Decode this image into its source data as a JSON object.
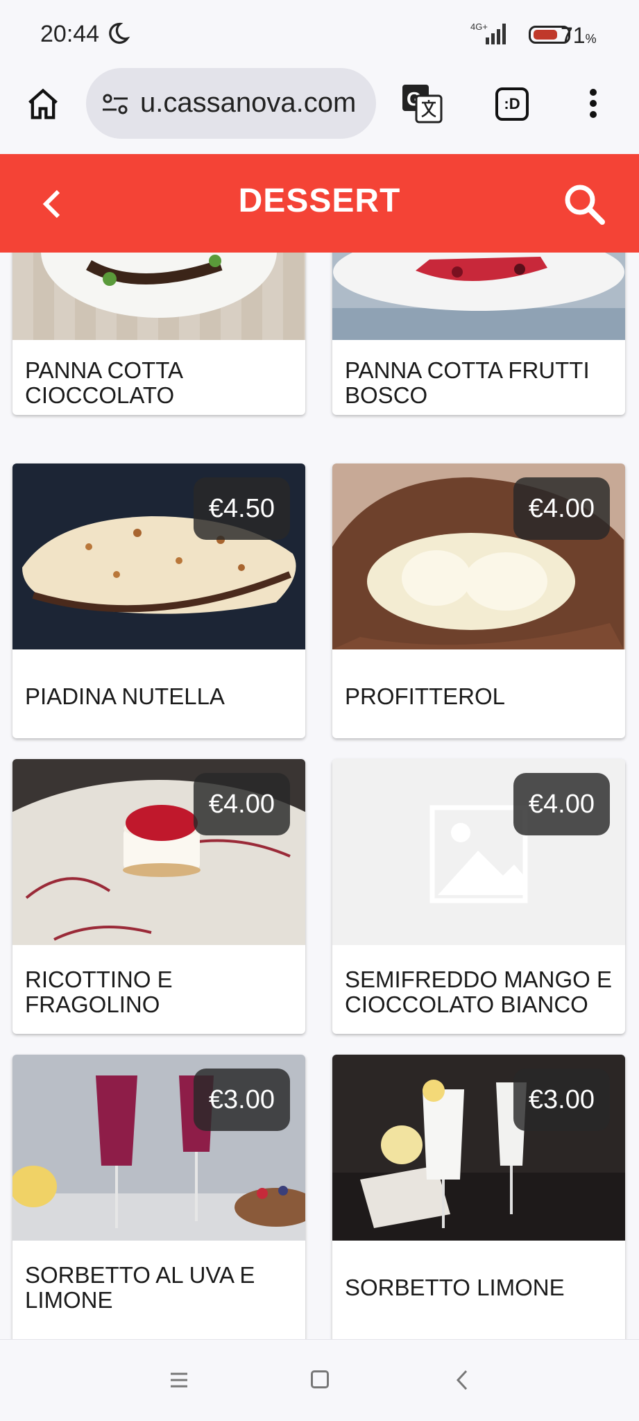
{
  "status_bar": {
    "time": "20:44",
    "network": "4G+",
    "battery": "71",
    "battery_unit": "%"
  },
  "browser": {
    "url": "u.cassanova.com",
    "extension_label": ":D"
  },
  "header": {
    "title": "DESSERT"
  },
  "menu_items": [
    {
      "name": "PANNA COTTA CIOCCOLATO",
      "price": ""
    },
    {
      "name": "PANNA COTTA FRUTTI BOSCO",
      "price": ""
    },
    {
      "name": "PIADINA NUTELLA",
      "price": "€4.50"
    },
    {
      "name": "PROFITTEROL",
      "price": "€4.00"
    },
    {
      "name": "RICOTTINO E FRAGOLINO",
      "price": "€4.00"
    },
    {
      "name": "SEMIFREDDO MANGO E CIOCCOLATO BIANCO",
      "price": "€4.00"
    },
    {
      "name": "SORBETTO AL UVA E LIMONE",
      "price": "€3.00"
    },
    {
      "name": "SORBETTO LIMONE",
      "price": "€3.00"
    }
  ],
  "colors": {
    "accent": "#f44336",
    "price_badge": "#2b2b2b"
  }
}
